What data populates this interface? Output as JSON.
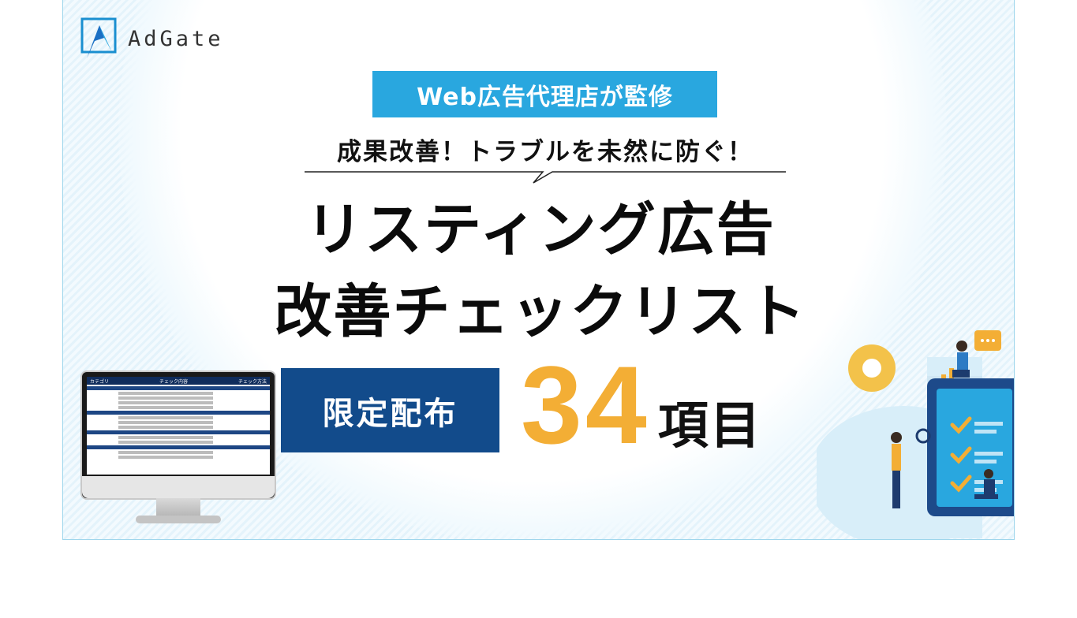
{
  "brand": {
    "name": "AdGate",
    "accent": "#29a7df",
    "navy": "#124b8b",
    "gold": "#f3ae35"
  },
  "badge": "Web広告代理店が監修",
  "tagline": "成果改善！トラブルを未然に防ぐ！",
  "headline": {
    "line1": "リスティング広告",
    "line2": "改善チェックリスト"
  },
  "limited_label": "限定配布",
  "item_count": {
    "number": "34",
    "unit": "項目"
  },
  "monitor_sheet": {
    "col_category": "カテゴリ",
    "col_content": "チェック内容",
    "col_check": "チェック方法"
  },
  "icons": [
    "adgate-logo-icon",
    "monitor-icon",
    "checklist-illustration-icon",
    "gear-icon",
    "chat-bubble-icon",
    "lightbulb-icon"
  ]
}
